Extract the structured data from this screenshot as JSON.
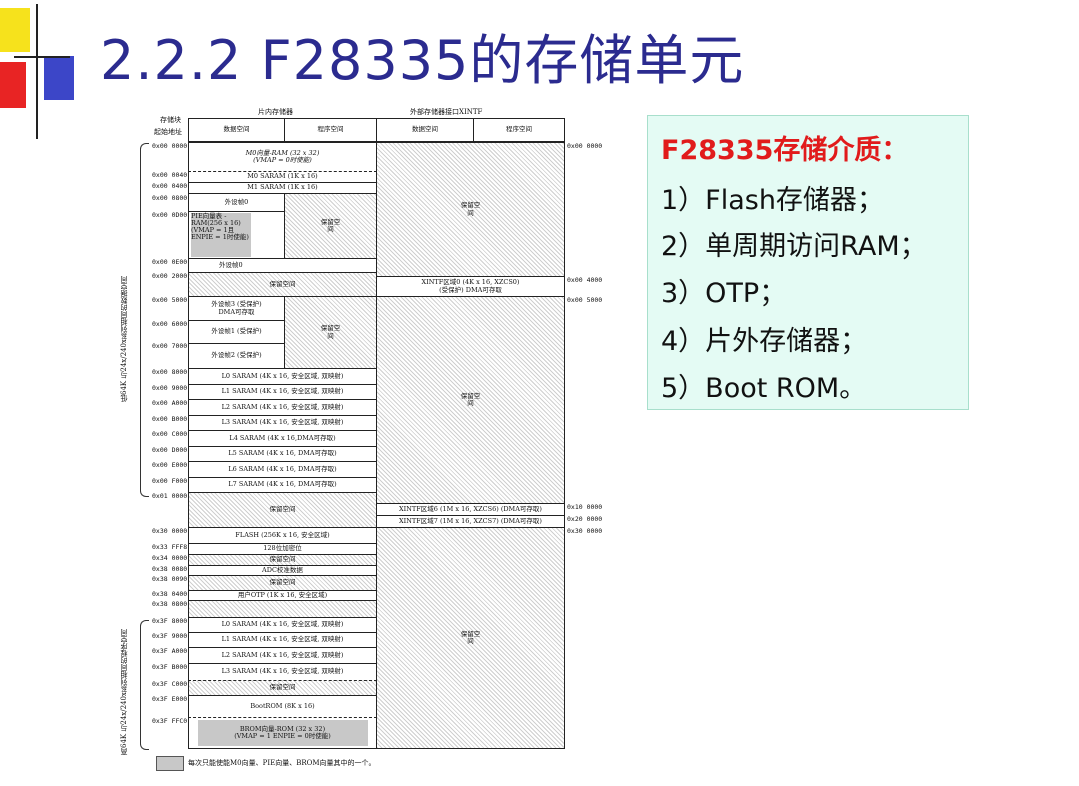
{
  "title": "2.2.2 F28335的存储单元",
  "map": {
    "header": {
      "block_start": "存储块",
      "start_addr": "起始地址",
      "onchip": "片内存储器",
      "external": "外部存储器接口XINTF",
      "data_space": "数据空间",
      "prog_space": "程序空间",
      "ext_data_space": "数据空间",
      "ext_prog_space": "程序空间"
    },
    "left_addrs": [
      "0x00 0000",
      "0x00 0040",
      "0x00 0400",
      "0x00 0800",
      "0x00 0D00",
      "0x00 0E00",
      "0x00 2000",
      "0x00 5000",
      "0x00 6000",
      "0x00 7000",
      "0x00 8000",
      "0x00 9000",
      "0x00 A000",
      "0x00 B000",
      "0x00 C000",
      "0x00 D000",
      "0x00 E000",
      "0x00 F000",
      "0x01 0000",
      "0x30 0000",
      "0x33 FFF8",
      "0x34 0000",
      "0x38 0080",
      "0x38 0090",
      "0x38 0400",
      "0x38 0800",
      "0x3F 8000",
      "0x3F 9000",
      "0x3F A000",
      "0x3F B000",
      "0x3F C000",
      "0x3F E000",
      "0x3F FFC0"
    ],
    "right_addrs": [
      "0x00 0000",
      "0x00 4000",
      "0x00 5000",
      "0x10 0000",
      "0x20 0000",
      "0x30 0000"
    ],
    "blocks": {
      "m0_vector": "M0向量-RAM (32 x 32)",
      "m0_vector_note": "(VMAP = 0时使能)",
      "m0_saram": "M0 SARAM (1K x 16)",
      "m1_saram": "M1 SARAM (1K x 16)",
      "pf0": "外设帧0",
      "pie": "PIE向量表 - RAM(256 x 16) (VMAP = 1且ENPIE = 1时使能)",
      "reserved": "保留空间",
      "pf0b": "外设帧0",
      "reserved2": "保留空间",
      "xintf0": "XINTF区域0 (4K x 16, XZCS0)",
      "xintf0_note": "(受保护) DMA可存取",
      "pf3": "外设帧3 (受保护)",
      "pf3_dma": "DMA可存取",
      "pf1": "外设帧1 (受保护)",
      "pf2": "外设帧2 (受保护)",
      "l0": "L0 SARAM (4K x 16, 安全区域, 双映射)",
      "l1": "L1 SARAM (4K x 16, 安全区域, 双映射)",
      "l2": "L2 SARAM (4K x 16, 安全区域, 双映射)",
      "l3": "L3 SARAM (4K x 16, 安全区域, 双映射)",
      "l4": "L4 SARAM (4K x 16,DMA可存取)",
      "l5": "L5 SARAM (4K x 16, DMA可存取)",
      "l6": "L6 SARAM (4K x 16, DMA可存取)",
      "l7": "L7 SARAM (4K x 16, DMA可存取)",
      "xintf6": "XINTF区域6 (1M x 16, XZCS6) (DMA可存取)",
      "xintf7": "XINTF区域7 (1M x 16, XZCS7) (DMA可存取)",
      "flash": "FLASH (256K x 16, 安全区域)",
      "pw": "128位加密位",
      "adc": "ADC校准数据",
      "otp": "用户OTP (1K x 16, 安全区域)",
      "l0b": "L0 SARAM (4K x 16, 安全区域, 双映射)",
      "l1b": "L1 SARAM (4K x 16, 安全区域, 双映射)",
      "l2b": "L2 SARAM (4K x 16, 安全区域, 双映射)",
      "l3b": "L3 SARAM (4K x 16, 安全区域, 双映射)",
      "boot": "BootROM (8K x 16)",
      "brom": "BROM向量-ROM (32 x 32) (VMAP = 1 ENPIE = 0时使能)"
    },
    "side_low": "低64K 与24x/240x系列相同的数据空间",
    "side_high": "高64K 与24x/240x系列相同的程序空间",
    "legend": "每次只能使能M0向量、PIE向量、BROM向量其中的一个。"
  },
  "panel": {
    "heading": "F28335存储介质：",
    "items": [
      "1）Flash存储器；",
      "2）单周期访问RAM；",
      "3）OTP；",
      "4）片外存储器；",
      "5）Boot ROM。"
    ]
  },
  "colors": {
    "title": "#2b2b8f",
    "panel_bg": "#e4fbf4",
    "heading": "#e11b1b"
  }
}
